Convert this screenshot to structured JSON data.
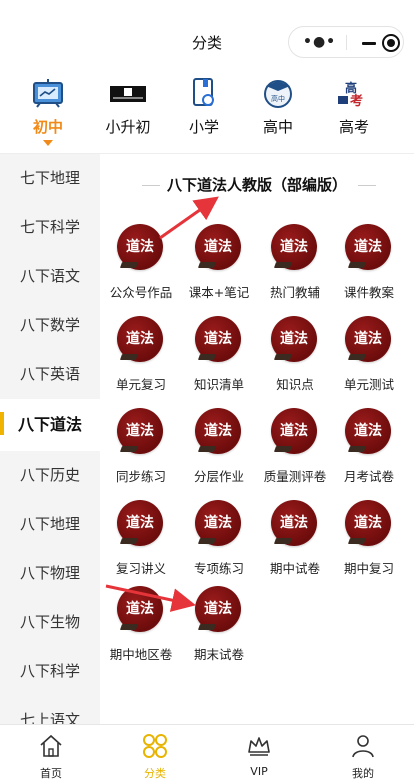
{
  "window": {
    "title": "分类"
  },
  "levels": [
    {
      "label": "初中",
      "icon": "chart-board-icon",
      "active": true
    },
    {
      "label": "小升初",
      "icon": "xiaoshengchu-banner-icon",
      "active": false
    },
    {
      "label": "小学",
      "icon": "book-link-icon",
      "active": false
    },
    {
      "label": "高中",
      "icon": "graduation-cap-icon",
      "active": false
    },
    {
      "label": "高考",
      "icon": "gaokao-text-icon",
      "active": false
    }
  ],
  "level_icon_texts": {
    "gaozhong": "高中",
    "gaokao_a": "高",
    "gaokao_b": "考"
  },
  "sidebar": {
    "items": [
      {
        "label": "七下地理"
      },
      {
        "label": "七下科学"
      },
      {
        "label": "八下语文"
      },
      {
        "label": "八下数学"
      },
      {
        "label": "八下英语"
      },
      {
        "label": "八下道法",
        "active": true
      },
      {
        "label": "八下历史"
      },
      {
        "label": "八下地理"
      },
      {
        "label": "八下物理"
      },
      {
        "label": "八下生物"
      },
      {
        "label": "八下科学"
      },
      {
        "label": "七上语文"
      }
    ]
  },
  "main": {
    "section_title": "八下道法人教版（部编版）",
    "badge_text": "道法",
    "items": [
      {
        "label": "公众号作品"
      },
      {
        "label": "课本+笔记"
      },
      {
        "label": "热门教辅"
      },
      {
        "label": "课件教案"
      },
      {
        "label": "单元复习"
      },
      {
        "label": "知识清单"
      },
      {
        "label": "知识点"
      },
      {
        "label": "单元测试"
      },
      {
        "label": "同步练习"
      },
      {
        "label": "分层作业"
      },
      {
        "label": "质量测评卷"
      },
      {
        "label": "月考试卷"
      },
      {
        "label": "复习讲义"
      },
      {
        "label": "专项练习"
      },
      {
        "label": "期中试卷"
      },
      {
        "label": "期中复习"
      },
      {
        "label": "期中地区卷"
      },
      {
        "label": "期末试卷"
      }
    ]
  },
  "tabbar": [
    {
      "label": "首页",
      "icon": "home-icon",
      "active": false
    },
    {
      "label": "分类",
      "icon": "category-icon",
      "active": true
    },
    {
      "label": "VIP",
      "icon": "crown-icon",
      "active": false
    },
    {
      "label": "我的",
      "icon": "user-icon",
      "active": false
    }
  ],
  "colors": {
    "accent_orange": "#f08a18",
    "accent_yellow": "#e8b400",
    "badge_red": "#7a1010",
    "arrow_red": "#e5343a"
  }
}
